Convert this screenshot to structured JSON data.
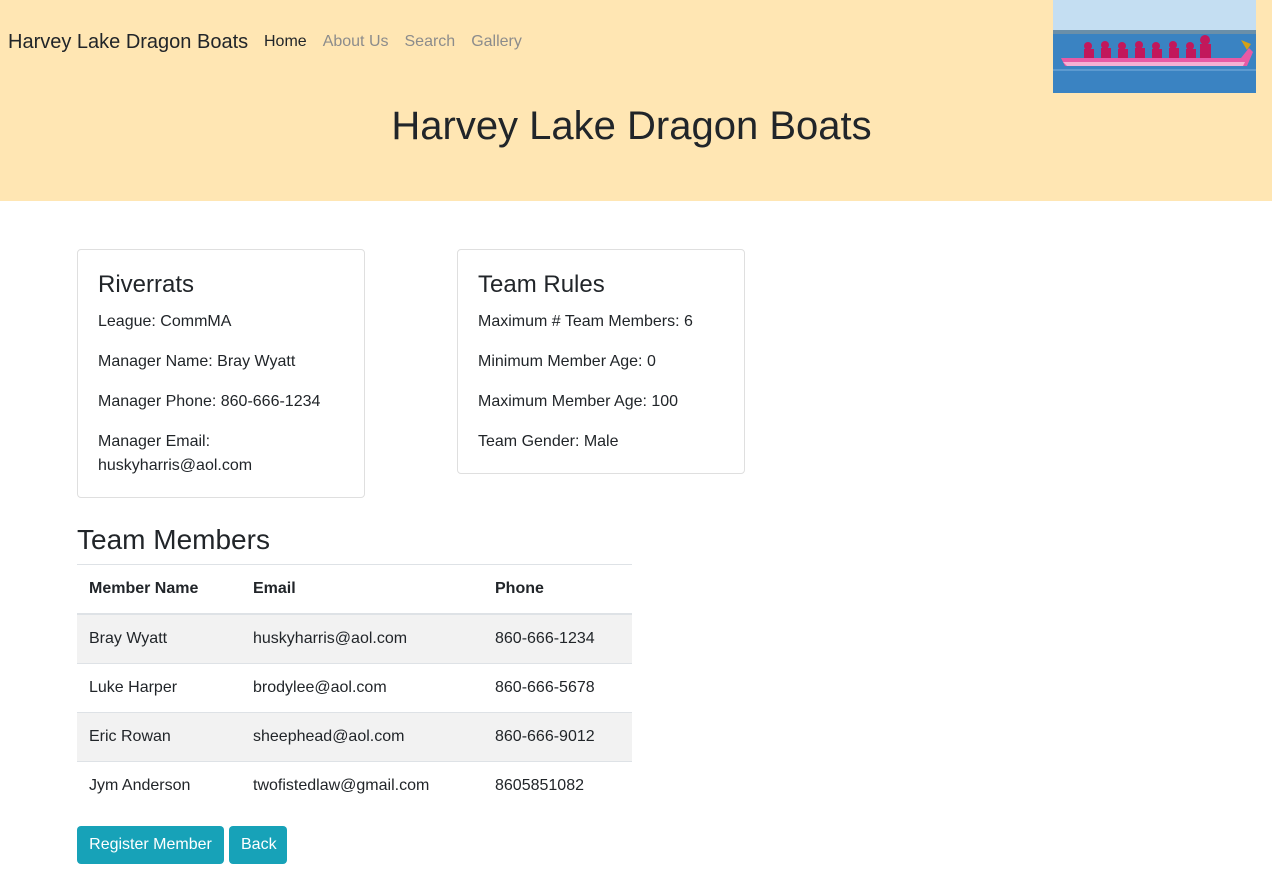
{
  "nav": {
    "brand": "Harvey Lake Dragon Boats",
    "links": [
      "Home",
      "About Us",
      "Search",
      "Gallery"
    ]
  },
  "header": {
    "title": "Harvey Lake Dragon Boats"
  },
  "team": {
    "name": "Riverrats",
    "league": "League: CommMA",
    "manager_name": "Manager Name: Bray Wyatt",
    "manager_phone": "Manager Phone: 860-666-1234",
    "manager_email": "Manager Email: huskyharris@aol.com"
  },
  "rules": {
    "title": "Team Rules",
    "max_members": "Maximum # Team Members: 6",
    "min_age": "Minimum Member Age: 0",
    "max_age": "Maximum Member Age: 100",
    "gender": "Team Gender: Male"
  },
  "members": {
    "title": "Team Members",
    "columns": [
      "Member Name",
      "Email",
      "Phone"
    ],
    "rows": [
      [
        "Bray Wyatt",
        "huskyharris@aol.com",
        "860-666-1234"
      ],
      [
        "Luke Harper",
        "brodylee@aol.com",
        "860-666-5678"
      ],
      [
        "Eric Rowan",
        "sheephead@aol.com",
        "860-666-9012"
      ],
      [
        "Jym Anderson",
        "twofistedlaw@gmail.com",
        "8605851082"
      ]
    ]
  },
  "buttons": {
    "register": "Register Member",
    "back": "Back"
  },
  "colors": {
    "header_bg": "#ffe6b3",
    "button": "#17a2b8"
  }
}
